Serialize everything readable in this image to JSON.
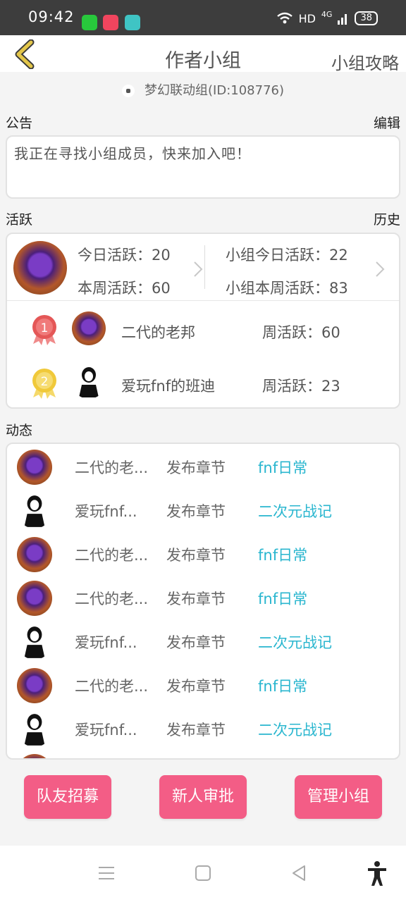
{
  "status_bar": {
    "time": "09:42",
    "network": "HD",
    "signal": "4G",
    "battery": "38"
  },
  "header": {
    "title": "作者小组",
    "guide_label": "小组攻略"
  },
  "group": {
    "name_id": "梦幻联动组(ID:108776)"
  },
  "notice": {
    "section_label": "公告",
    "edit_label": "编辑",
    "text": "我正在寻找小组成员，快来加入吧！"
  },
  "activity": {
    "section_label": "活跃",
    "history_label": "历史",
    "today": "今日活跃：20",
    "week": "本周活跃：60",
    "group_today": "小组今日活跃：22",
    "group_week": "小组本周活跃：83",
    "ranking": [
      {
        "rank": "1",
        "name": "二代的老邦",
        "weekly": "周活跃：60"
      },
      {
        "rank": "2",
        "name": "爱玩fnf的班迪",
        "weekly": "周活跃：23"
      }
    ]
  },
  "feed": {
    "section_label": "动态",
    "items": [
      {
        "user": "二代的老...",
        "action": "发布章节",
        "book": "fnf日常",
        "avatar": "purple"
      },
      {
        "user": "爱玩fnf...",
        "action": "发布章节",
        "book": "二次元战记",
        "avatar": "bendy"
      },
      {
        "user": "二代的老...",
        "action": "发布章节",
        "book": "fnf日常",
        "avatar": "purple"
      },
      {
        "user": "二代的老...",
        "action": "发布章节",
        "book": "fnf日常",
        "avatar": "purple"
      },
      {
        "user": "爱玩fnf...",
        "action": "发布章节",
        "book": "二次元战记",
        "avatar": "bendy"
      },
      {
        "user": "二代的老...",
        "action": "发布章节",
        "book": "fnf日常",
        "avatar": "purple"
      },
      {
        "user": "爱玩fnf...",
        "action": "发布章节",
        "book": "二次元战记",
        "avatar": "bendy"
      }
    ]
  },
  "buttons": {
    "recruit": "队友招募",
    "approve": "新人审批",
    "manage": "管理小组"
  },
  "colors": {
    "accent_pink": "#f35d86",
    "link_cyan": "#29b6cf",
    "back_arrow": "#e3c64a"
  }
}
